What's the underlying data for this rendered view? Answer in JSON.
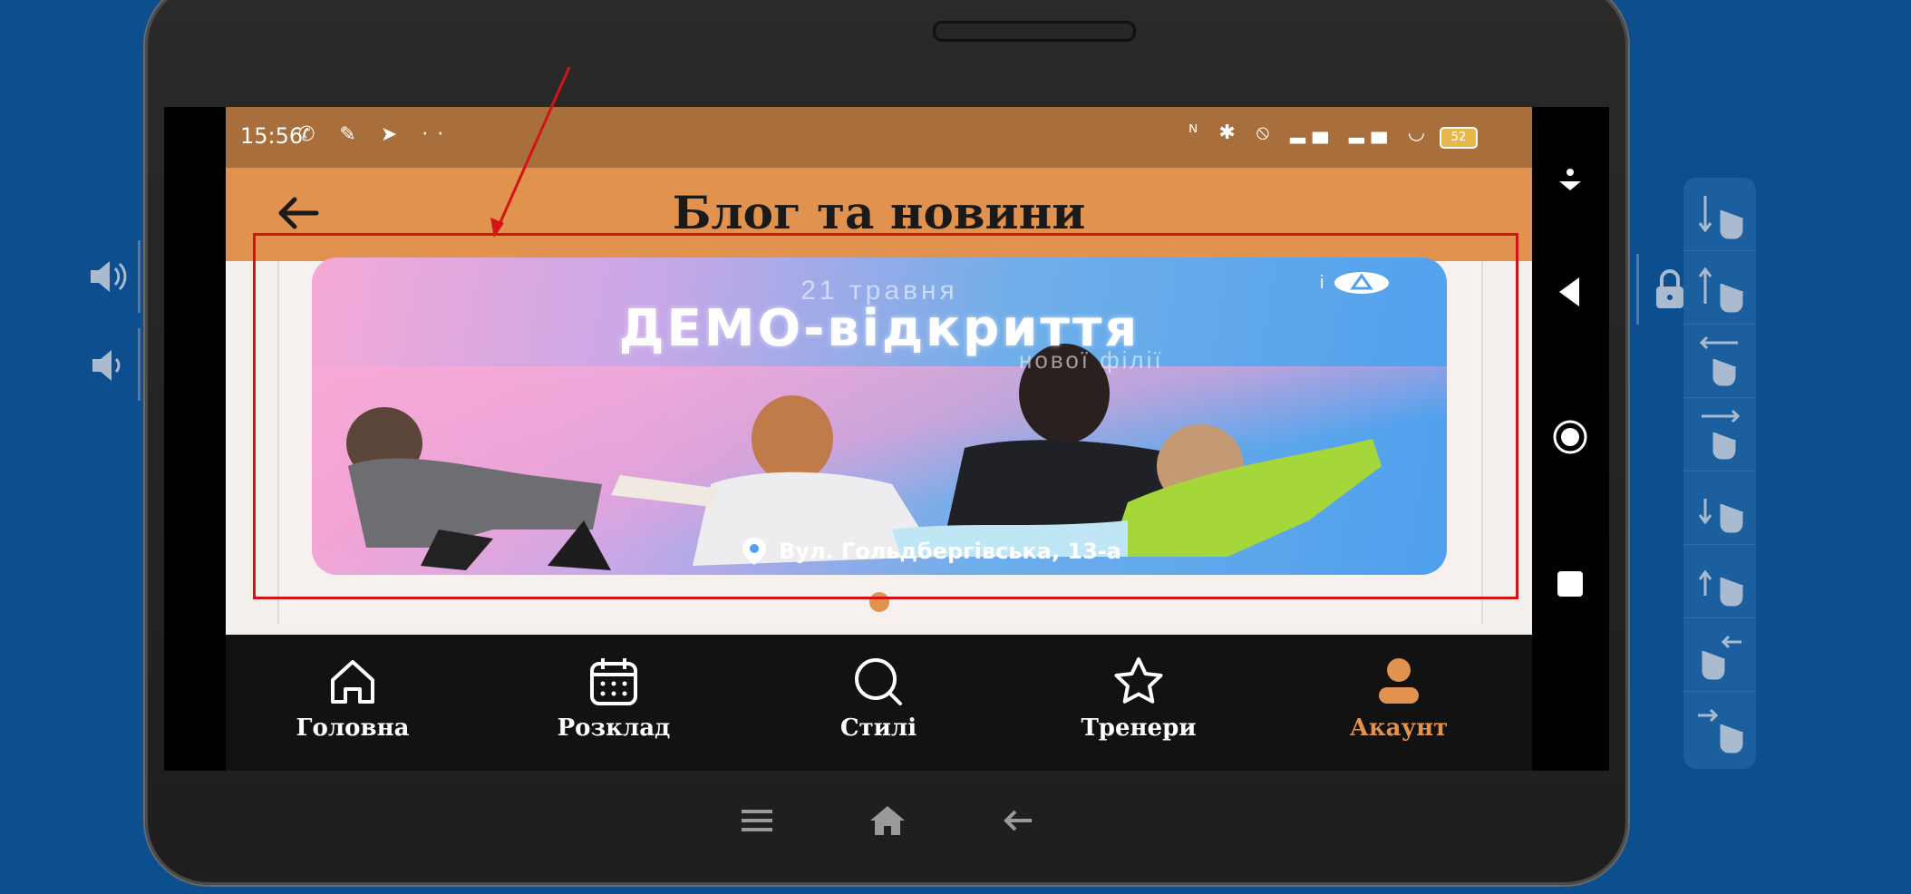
{
  "status_bar": {
    "time": "15:56",
    "left_icons": "✆ ✎ ➤ ··",
    "right_icons": "ᴺ ✱ ⦸ ▂▄ ▂▄ ◡",
    "battery": "52"
  },
  "app_bar": {
    "title": "Блог та новини"
  },
  "banner": {
    "date_text": "21 травня",
    "headline": "ДЕМО-відкриття",
    "subheadline": "нової філії",
    "address": "Вул. Гольдбергівська, 13-а"
  },
  "bottom_nav": {
    "items": [
      {
        "label": "Головна",
        "icon": "home-icon",
        "active": false
      },
      {
        "label": "Розклад",
        "icon": "calendar-icon",
        "active": false
      },
      {
        "label": "Стилі",
        "icon": "search-icon",
        "active": false
      },
      {
        "label": "Тренери",
        "icon": "star-icon",
        "active": false
      },
      {
        "label": "Акаунт",
        "icon": "person-icon",
        "active": true
      }
    ]
  },
  "colors": {
    "background": "#0d4e8e",
    "status_bar": "#a86f3d",
    "app_bar": "#e0924e",
    "accent": "#e0924e",
    "nav_bg": "#121212",
    "annotation": "#d31414"
  }
}
